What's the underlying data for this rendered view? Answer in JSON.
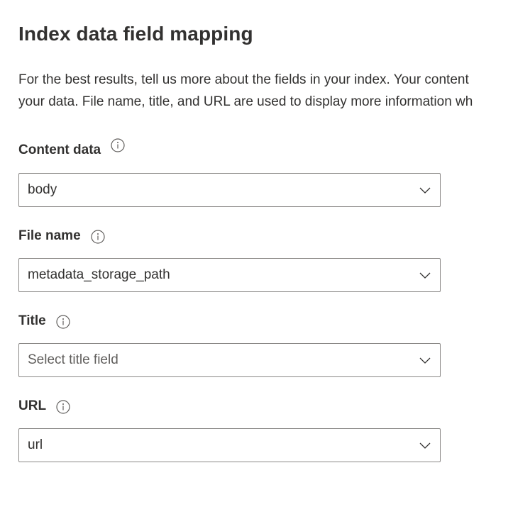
{
  "page": {
    "title": "Index data field mapping",
    "description_line1": "For the best results, tell us more about the fields in your index. Your content",
    "description_line2": "your data. File name, title, and URL are used to display more information wh"
  },
  "fields": {
    "content_data": {
      "label": "Content data",
      "value": "body",
      "icon": "info-icon"
    },
    "file_name": {
      "label": "File name",
      "value": "metadata_storage_path",
      "icon": "info-icon"
    },
    "title": {
      "label": "Title",
      "placeholder": "Select title field",
      "icon": "info-icon"
    },
    "url": {
      "label": "URL",
      "value": "url",
      "icon": "info-icon"
    }
  },
  "colors": {
    "text": "#323130",
    "placeholder": "#605e5c",
    "border": "#8a8886",
    "icon": "#605e5c"
  }
}
